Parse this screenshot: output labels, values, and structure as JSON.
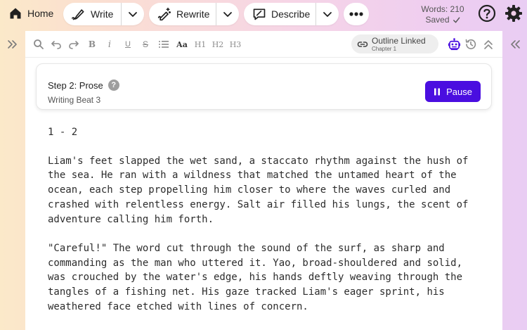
{
  "topbar": {
    "home_label": "Home",
    "write_label": "Write",
    "rewrite_label": "Rewrite",
    "describe_label": "Describe",
    "words_label": "Words: 210",
    "saved_label": "Saved"
  },
  "toolbar": {
    "aa_label": "Aa",
    "h1_label": "H1",
    "h2_label": "H2",
    "h3_label": "H3",
    "bold_label": "B",
    "italic_label": "i",
    "underline_label": "U",
    "strike_label": "S",
    "outline_label": "Outline Linked",
    "outline_sub": "Chapter 1"
  },
  "step": {
    "title": "Step 2: Prose",
    "subtitle": "Writing Beat 3",
    "help_glyph": "?",
    "pause_label": "Pause"
  },
  "document": {
    "heading": "1 - 2",
    "paragraphs": [
      "Liam's feet slapped the wet sand, a staccato rhythm against the hush of the sea. He ran with a wildness that matched the untamed heart of the ocean, each step propelling him closer to where the waves curled and crashed with relentless energy. Salt air filled his lungs, the scent of adventure calling him forth.",
      "\"Careful!\" The word cut through the sound of the surf, as sharp and commanding as the man who uttered it. Yao, broad-shouldered and solid, was crouched by the water's edge, his hands deftly weaving through the tangles of a fishing net. His gaze tracked Liam's eager sprint, his weathered face etched with lines of concern."
    ]
  },
  "colors": {
    "accent": "#4a0ee0",
    "help_icon": "#222222",
    "settings_icon": "#222222"
  },
  "icons": [
    "home-icon",
    "write-pen-icon",
    "rewrite-sparkle-pen-icon",
    "describe-chat-icon",
    "chevron-down-icon",
    "more-dots-icon",
    "check-icon",
    "help-icon",
    "settings-gear-icon",
    "double-chevron-right-icon",
    "double-chevron-left-icon",
    "search-icon",
    "undo-icon",
    "redo-icon",
    "list-icon",
    "link-icon",
    "robot-icon",
    "history-icon",
    "collapse-up-icon",
    "pause-icon"
  ]
}
